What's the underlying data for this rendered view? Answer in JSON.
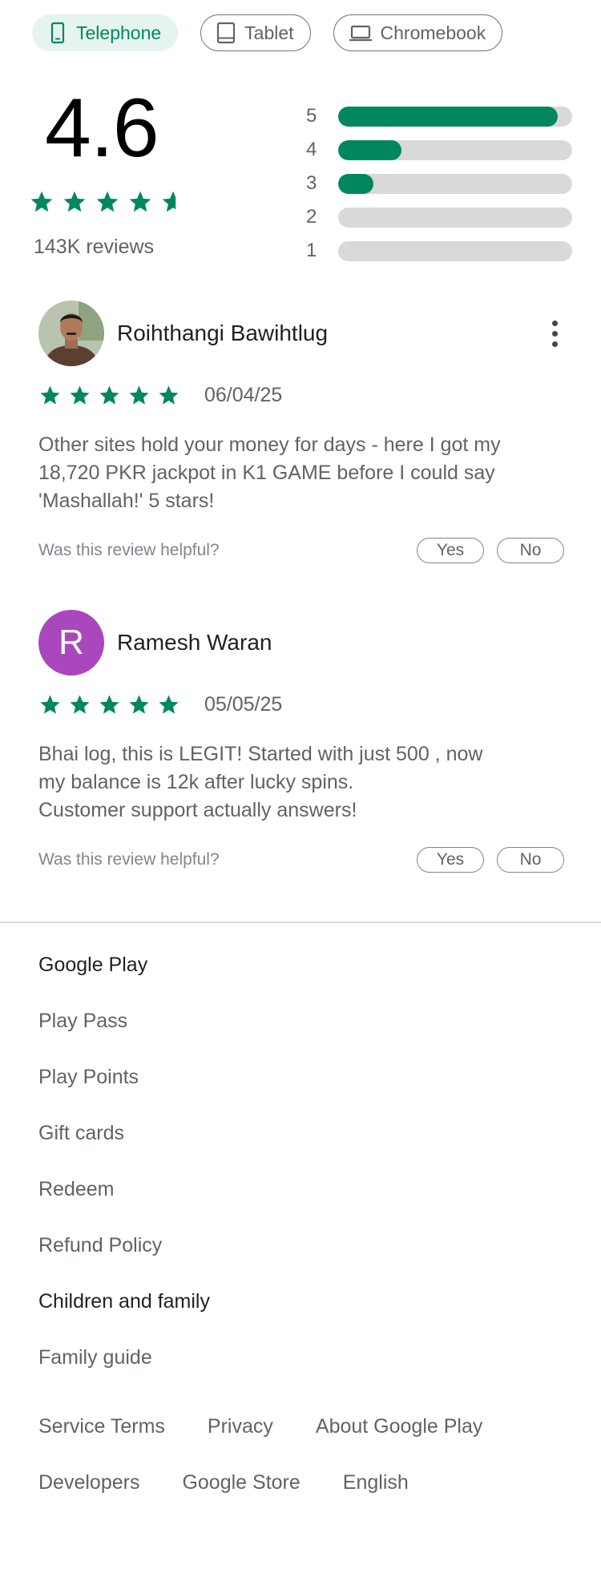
{
  "device_tabs": [
    {
      "label": "Telephone",
      "icon": "phone-icon",
      "active": true
    },
    {
      "label": "Tablet",
      "icon": "tablet-icon",
      "active": false
    },
    {
      "label": "Chromebook",
      "icon": "laptop-icon",
      "active": false
    }
  ],
  "rating": {
    "score": "4.6",
    "stars": 4.6,
    "review_count": "143K reviews",
    "distribution": [
      {
        "label": "5",
        "fraction": 0.94
      },
      {
        "label": "4",
        "fraction": 0.27
      },
      {
        "label": "3",
        "fraction": 0.15
      },
      {
        "label": "2",
        "fraction": 0.0
      },
      {
        "label": "1",
        "fraction": 0.0
      }
    ]
  },
  "reviews": [
    {
      "name": "Roihthangi Bawihtlug",
      "avatar": "photo",
      "stars": 5,
      "date": "06/04/25",
      "text": "Other sites hold your money for days - here I got my\n18,720 PKR jackpot in K1 GAME before I could say\n'Mashallah!' 5 stars!",
      "helpful_question": "Was this review helpful?",
      "yes_label": "Yes",
      "no_label": "No"
    },
    {
      "name": "Ramesh Waran",
      "avatar_letter": "R",
      "stars": 5,
      "date": "05/05/25",
      "text": "Bhai log, this is LEGIT! Started with just 500 , now\nmy balance is 12k after lucky spins.\nCustomer support actually answers!",
      "helpful_question": "Was this review helpful?",
      "yes_label": "Yes",
      "no_label": "No"
    }
  ],
  "footer": {
    "google_play_heading": "Google Play",
    "google_play_links": [
      "Play Pass",
      "Play Points",
      "Gift cards",
      "Redeem",
      "Refund Policy"
    ],
    "family_heading": "Children and family",
    "family_links": [
      "Family guide"
    ],
    "bottom_row1": [
      "Service Terms",
      "Privacy",
      "About Google Play"
    ],
    "bottom_row2": [
      "Developers",
      "Google Store",
      "English"
    ]
  },
  "colors": {
    "accent": "#01875f",
    "active_chip_bg": "#e6f4ef",
    "bar_track": "#d9d9d9",
    "avatar_purple": "#ab47bc"
  }
}
